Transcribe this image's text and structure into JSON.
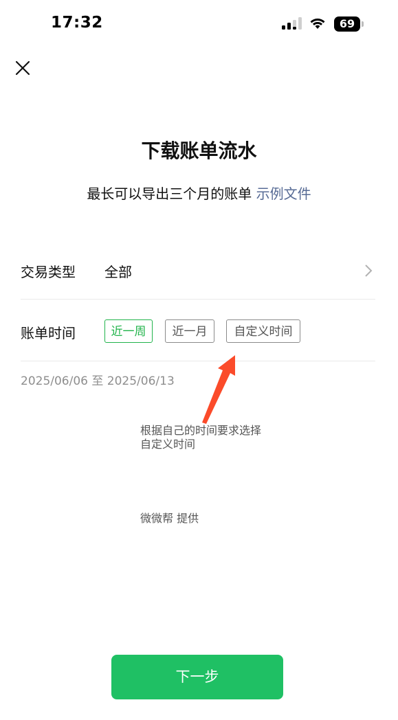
{
  "status_bar": {
    "time": "17:32",
    "battery": "69"
  },
  "header": {
    "title": "下载账单流水",
    "subtitle": "最长可以导出三个月的账单",
    "sample_link": "示例文件"
  },
  "transaction_type": {
    "label": "交易类型",
    "value": "全部"
  },
  "bill_time": {
    "label": "账单时间",
    "options": [
      "近一周",
      "近一月",
      "自定义时间"
    ],
    "selected": "近一周",
    "range_text": "2025/06/06 至 2025/06/13"
  },
  "annotation": {
    "line1": "根据自己的时间要求选择",
    "line2": "自定义时间",
    "provider": "微微帮 提供"
  },
  "footer": {
    "next_label": "下一步"
  },
  "colors": {
    "accent": "#1fc064",
    "link": "#576b95",
    "arrow": "#fb4b2a"
  },
  "icons": {
    "close": "close-icon",
    "chevron": "chevron-right-icon"
  }
}
